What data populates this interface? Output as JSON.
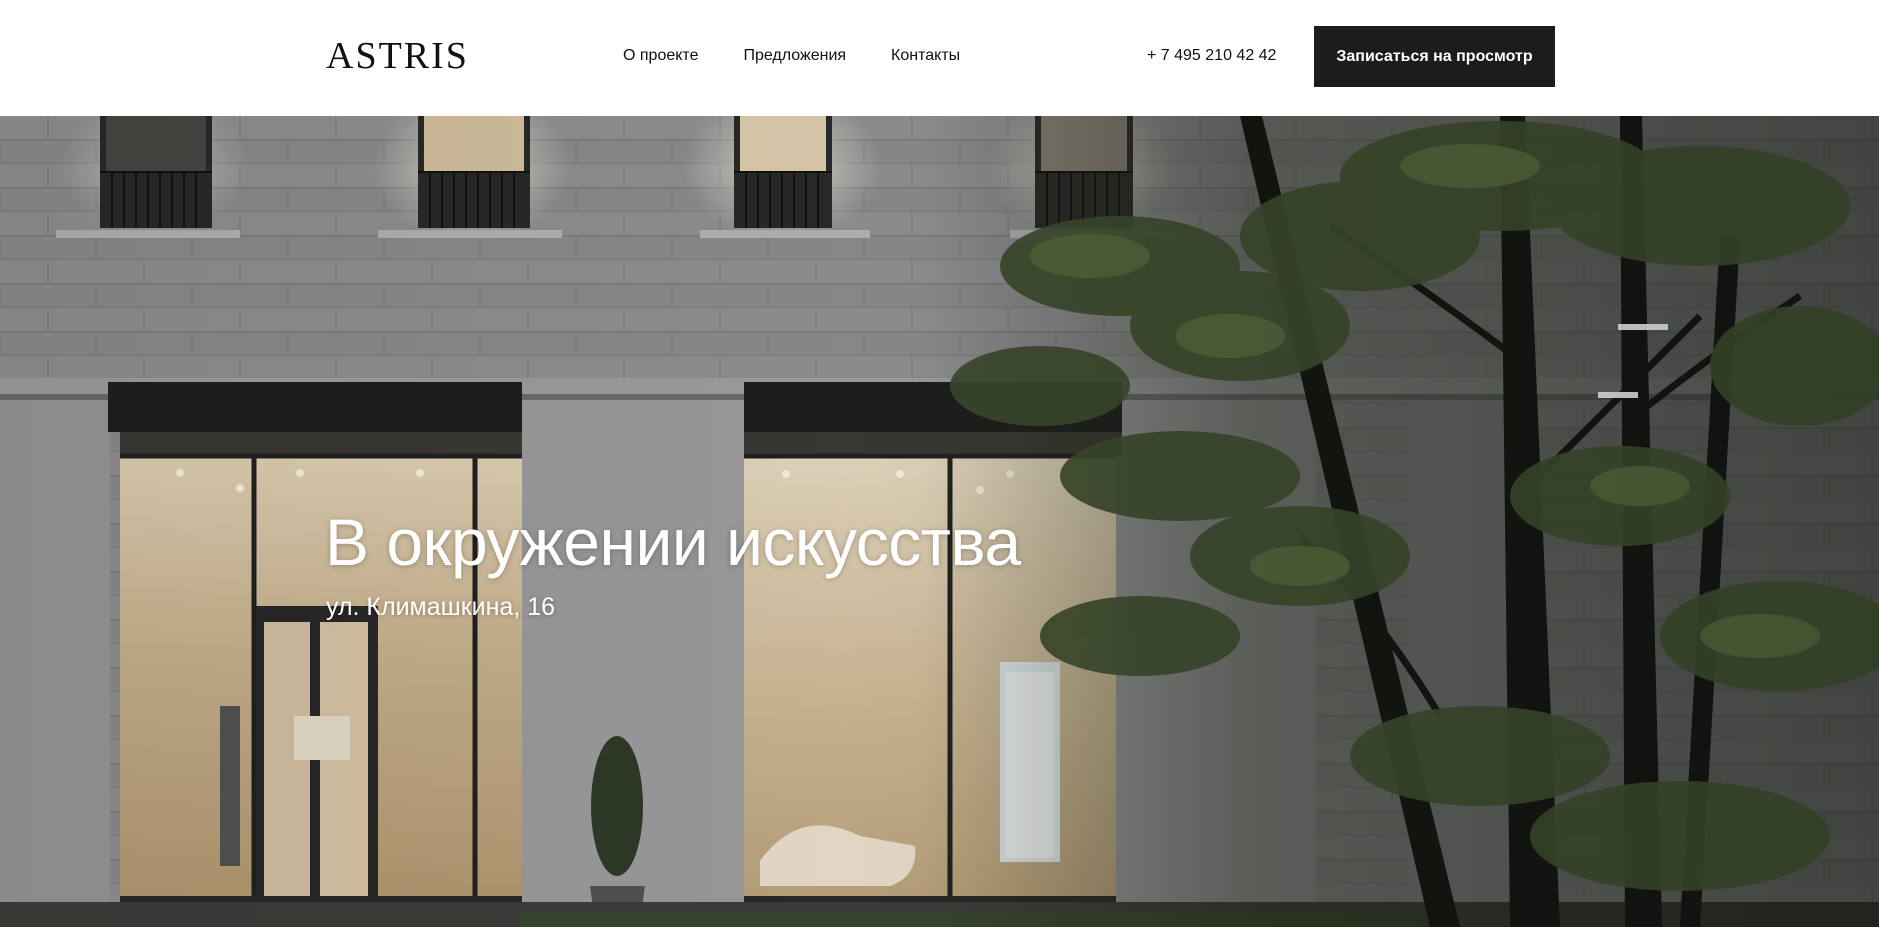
{
  "header": {
    "logo": "ASTRIS",
    "nav": [
      {
        "label": "О проекте"
      },
      {
        "label": "Предложения"
      },
      {
        "label": "Контакты"
      }
    ],
    "phone": "+ 7 495 210 42 42",
    "cta_label": "Записаться на просмотр"
  },
  "hero": {
    "title": "В окружении искусства",
    "address": "ул. Климашкина, 16"
  },
  "colors": {
    "header_bg": "#ffffff",
    "text": "#111111",
    "button_bg": "#1c1c1c",
    "button_text": "#ffffff",
    "hero_text": "#ffffff"
  }
}
